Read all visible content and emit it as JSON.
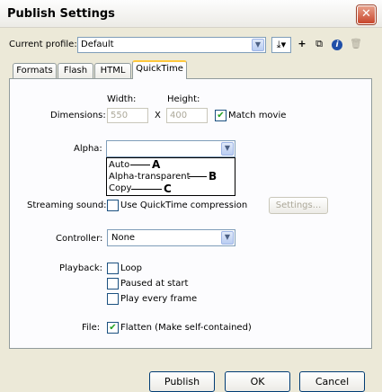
{
  "window": {
    "title": "Publish Settings",
    "close_glyph": "✕"
  },
  "profile": {
    "label": "Current profile:",
    "value": "Default",
    "toolbar_icons": [
      "import-export-icon",
      "add-profile-icon",
      "duplicate-profile-icon",
      "info-icon",
      "delete-profile-icon"
    ]
  },
  "tabs": [
    {
      "label": "Formats",
      "active": false
    },
    {
      "label": "Flash",
      "active": false
    },
    {
      "label": "HTML",
      "active": false
    },
    {
      "label": "QuickTime",
      "active": true
    }
  ],
  "dimensions": {
    "label": "Dimensions:",
    "width_label": "Width:",
    "height_label": "Height:",
    "width_value": "550",
    "height_value": "400",
    "separator": "X",
    "match_movie_label": "Match movie",
    "match_movie_checked": true
  },
  "alpha": {
    "label": "Alpha:",
    "value": "",
    "options": [
      {
        "label": "Auto",
        "callout": "A"
      },
      {
        "label": "Alpha-transparent",
        "callout": "B"
      },
      {
        "label": "Copy",
        "callout": "C"
      }
    ]
  },
  "streaming_sound": {
    "label": "Streaming sound:",
    "checkbox_label": "Use QuickTime compression",
    "checked": false,
    "settings_button": "Settings..."
  },
  "controller": {
    "label": "Controller:",
    "value": "None"
  },
  "playback": {
    "label": "Playback:",
    "options": [
      {
        "label": "Loop",
        "checked": false
      },
      {
        "label": "Paused at start",
        "checked": false
      },
      {
        "label": "Play every frame",
        "checked": false
      }
    ]
  },
  "file": {
    "label": "File:",
    "checkbox_label": "Flatten (Make self-contained)",
    "checked": true
  },
  "buttons": {
    "publish": "Publish",
    "ok": "OK",
    "cancel": "Cancel"
  },
  "colors": {
    "title_bar": "#ecebe6",
    "dialog_bg": "#ece9d8",
    "panel_bg": "#fcfcfe",
    "close_red": "#c8462c",
    "active_tab_accent": "#ffc83c",
    "check_green": "#21a121"
  }
}
